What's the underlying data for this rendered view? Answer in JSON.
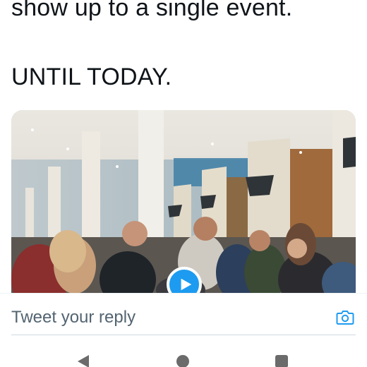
{
  "tweet": {
    "line1": "show up to a single event.",
    "line2": "UNTIL TODAY."
  },
  "media": {
    "type": "video",
    "play_icon": "play-icon",
    "accent_color": "#1d9bf0"
  },
  "reply": {
    "placeholder": "Tweet your reply",
    "camera_icon": "camera-icon"
  },
  "nav": {
    "back_icon": "back-triangle-icon",
    "home_icon": "home-circle-icon",
    "recents_icon": "recents-square-icon"
  }
}
